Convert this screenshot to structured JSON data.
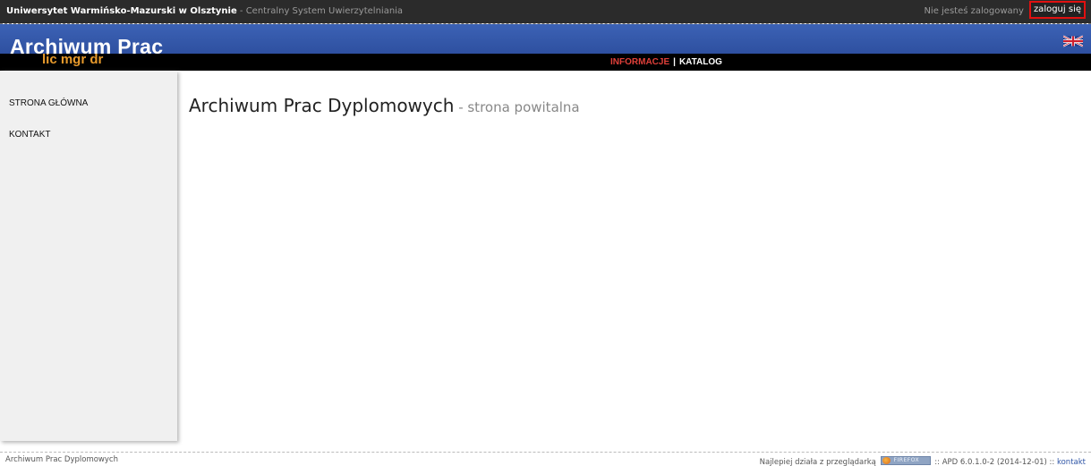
{
  "topbar": {
    "university": "Uniwersytet Warmińsko-Mazurski w Olsztynie",
    "separator": " - ",
    "cas": "Centralny System Uwierzytelniania",
    "not_logged": "Nie jesteś zalogowany",
    "login": "zaloguj się"
  },
  "header": {
    "app_title": "Archiwum Prac",
    "degrees": "lic mgr dr",
    "language_icon": "uk-flag-icon"
  },
  "nav": {
    "items": [
      {
        "label": "INFORMACJE",
        "active": true
      },
      {
        "label": "KATALOG",
        "active": false
      }
    ],
    "separator": "|"
  },
  "sidebar": {
    "items": [
      {
        "label": "STRONA GŁÓWNA"
      },
      {
        "label": "KONTAKT"
      }
    ]
  },
  "main": {
    "title": "Archiwum Prac Dyplomowych",
    "subtitle": " - strona powitalna"
  },
  "footer": {
    "left": "Archiwum Prac Dyplomowych",
    "browser_prefix": "Najlepiej działa z przeglądarką",
    "browser_badge": "FIREFOX",
    "version": ":: APD 6.0.1.0-2 (2014-12-01) ::",
    "contact": "kontakt"
  },
  "colors": {
    "topbar": "#2b2b2b",
    "header_blue": "#3558aa",
    "nav_active": "#e0403a",
    "degrees": "#e79a2c",
    "login_border": "#e01010"
  }
}
